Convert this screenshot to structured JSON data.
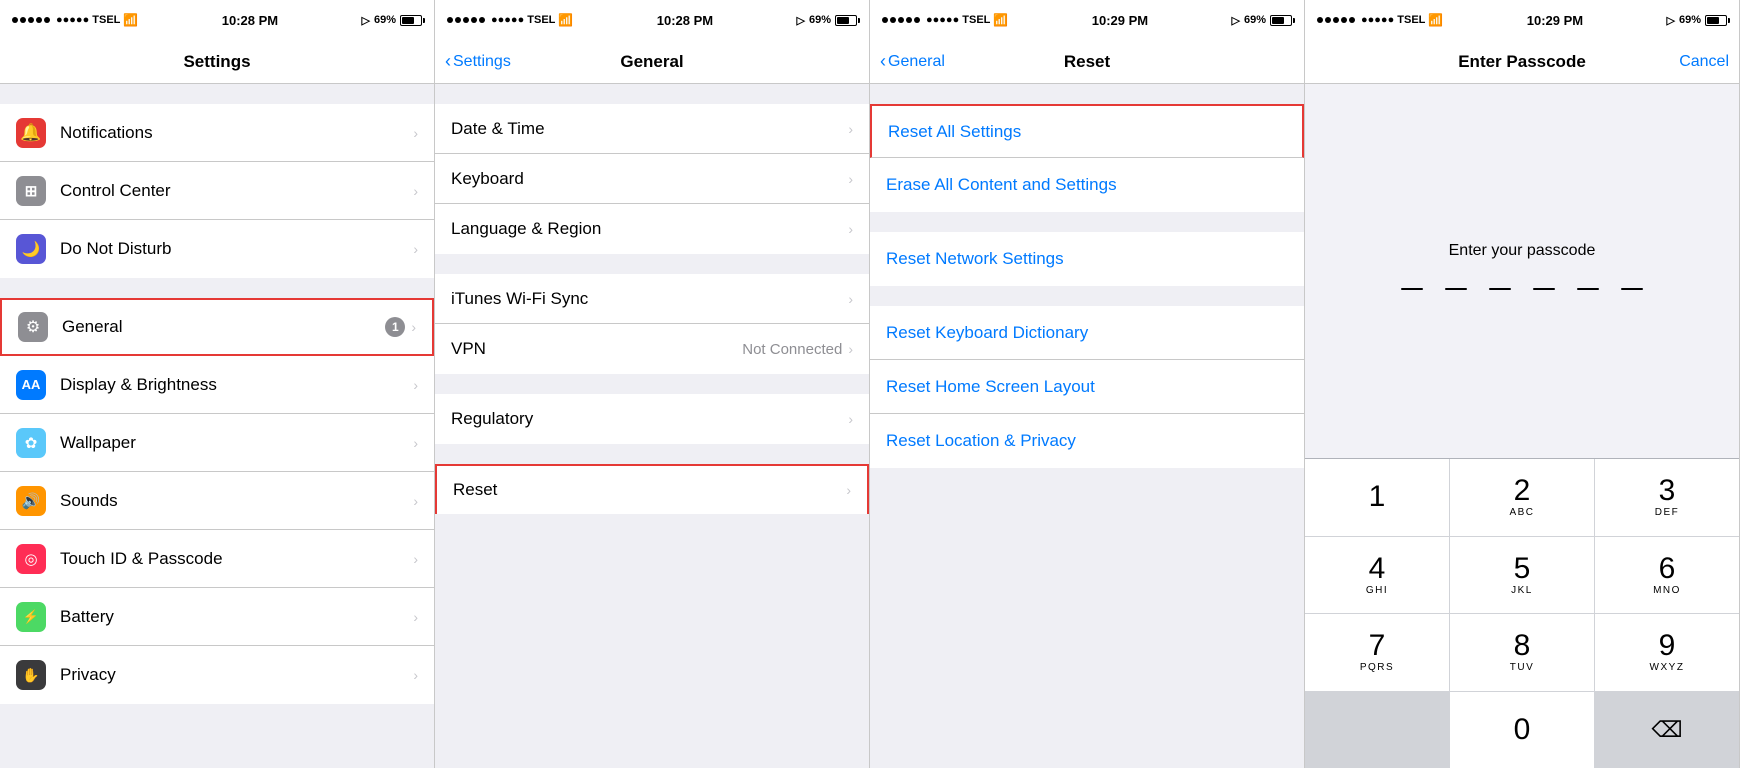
{
  "panels": [
    {
      "id": "settings",
      "status": {
        "carrier": "●●●●● TSEL",
        "wifi": "WiFi",
        "time": "10:28 PM",
        "location": true,
        "battery": "69%"
      },
      "nav": {
        "title": "Settings",
        "back": null,
        "cancel": null
      },
      "sections": [
        {
          "items": [
            {
              "icon_bg": "icon-red",
              "icon": "🔔",
              "label": "Notifications",
              "value": "",
              "chevron": true,
              "badge": null,
              "highlighted": false
            },
            {
              "icon_bg": "icon-gray",
              "icon": "⚙",
              "label": "Control Center",
              "value": "",
              "chevron": true,
              "badge": null,
              "highlighted": false
            },
            {
              "icon_bg": "icon-purple",
              "icon": "🌙",
              "label": "Do Not Disturb",
              "value": "",
              "chevron": true,
              "badge": null,
              "highlighted": false
            }
          ]
        },
        {
          "items": [
            {
              "icon_bg": "icon-gray",
              "icon": "⚙",
              "label": "General",
              "value": "",
              "chevron": true,
              "badge": "1",
              "highlighted": true
            },
            {
              "icon_bg": "icon-blue",
              "icon": "AA",
              "label": "Display & Brightness",
              "value": "",
              "chevron": true,
              "badge": null,
              "highlighted": false
            },
            {
              "icon_bg": "icon-teal",
              "icon": "✿",
              "label": "Wallpaper",
              "value": "",
              "chevron": true,
              "badge": null,
              "highlighted": false
            },
            {
              "icon_bg": "icon-orange",
              "icon": "🔊",
              "label": "Sounds",
              "value": "",
              "chevron": true,
              "badge": null,
              "highlighted": false
            },
            {
              "icon_bg": "icon-pink",
              "icon": "◎",
              "label": "Touch ID & Passcode",
              "value": "",
              "chevron": true,
              "badge": null,
              "highlighted": false
            },
            {
              "icon_bg": "icon-green",
              "icon": "⊡",
              "label": "Battery",
              "value": "",
              "chevron": true,
              "badge": null,
              "highlighted": false
            },
            {
              "icon_bg": "icon-dark",
              "icon": "✋",
              "label": "Privacy",
              "value": "",
              "chevron": true,
              "badge": null,
              "highlighted": false
            }
          ]
        }
      ]
    },
    {
      "id": "general",
      "status": {
        "carrier": "●●●●● TSEL",
        "wifi": "WiFi",
        "time": "10:28 PM",
        "location": true,
        "battery": "69%"
      },
      "nav": {
        "title": "General",
        "back": "Settings",
        "cancel": null
      },
      "sections": [
        {
          "items": [
            {
              "label": "Date & Time",
              "value": "",
              "chevron": true,
              "highlighted": false
            },
            {
              "label": "Keyboard",
              "value": "",
              "chevron": true,
              "highlighted": false
            },
            {
              "label": "Language & Region",
              "value": "",
              "chevron": true,
              "highlighted": false
            }
          ]
        },
        {
          "items": [
            {
              "label": "iTunes Wi-Fi Sync",
              "value": "",
              "chevron": true,
              "highlighted": false
            },
            {
              "label": "VPN",
              "value": "Not Connected",
              "chevron": true,
              "highlighted": false
            }
          ]
        },
        {
          "items": [
            {
              "label": "Regulatory",
              "value": "",
              "chevron": true,
              "highlighted": false
            }
          ]
        },
        {
          "items": [
            {
              "label": "Reset",
              "value": "",
              "chevron": true,
              "highlighted": true
            }
          ]
        }
      ]
    },
    {
      "id": "reset",
      "status": {
        "carrier": "●●●●● TSEL",
        "wifi": "WiFi",
        "time": "10:29 PM",
        "location": true,
        "battery": "69%"
      },
      "nav": {
        "title": "Reset",
        "back": "General",
        "cancel": null
      },
      "sections": [
        {
          "items": [
            {
              "label": "Reset All Settings",
              "highlighted": true
            },
            {
              "label": "Erase All Content and Settings",
              "highlighted": false
            }
          ]
        },
        {
          "items": [
            {
              "label": "Reset Network Settings",
              "highlighted": false
            }
          ]
        },
        {
          "items": [
            {
              "label": "Reset Keyboard Dictionary",
              "highlighted": false
            },
            {
              "label": "Reset Home Screen Layout",
              "highlighted": false
            },
            {
              "label": "Reset Location & Privacy",
              "highlighted": false
            }
          ]
        }
      ]
    },
    {
      "id": "passcode",
      "status": {
        "carrier": "●●●●● TSEL",
        "wifi": "WiFi",
        "time": "10:29 PM",
        "location": true,
        "battery": "69%"
      },
      "nav": {
        "title": "Enter Passcode",
        "back": null,
        "cancel": "Cancel"
      },
      "prompt": "Enter your passcode",
      "numpad": [
        {
          "main": "1",
          "sub": ""
        },
        {
          "main": "2",
          "sub": "ABC"
        },
        {
          "main": "3",
          "sub": "DEF"
        },
        {
          "main": "4",
          "sub": "GHI"
        },
        {
          "main": "5",
          "sub": "JKL"
        },
        {
          "main": "6",
          "sub": "MNO"
        },
        {
          "main": "7",
          "sub": "PQRS"
        },
        {
          "main": "8",
          "sub": "TUV"
        },
        {
          "main": "9",
          "sub": "WXYZ"
        },
        {
          "main": "",
          "sub": ""
        },
        {
          "main": "0",
          "sub": ""
        },
        {
          "main": "⌫",
          "sub": ""
        }
      ]
    }
  ]
}
